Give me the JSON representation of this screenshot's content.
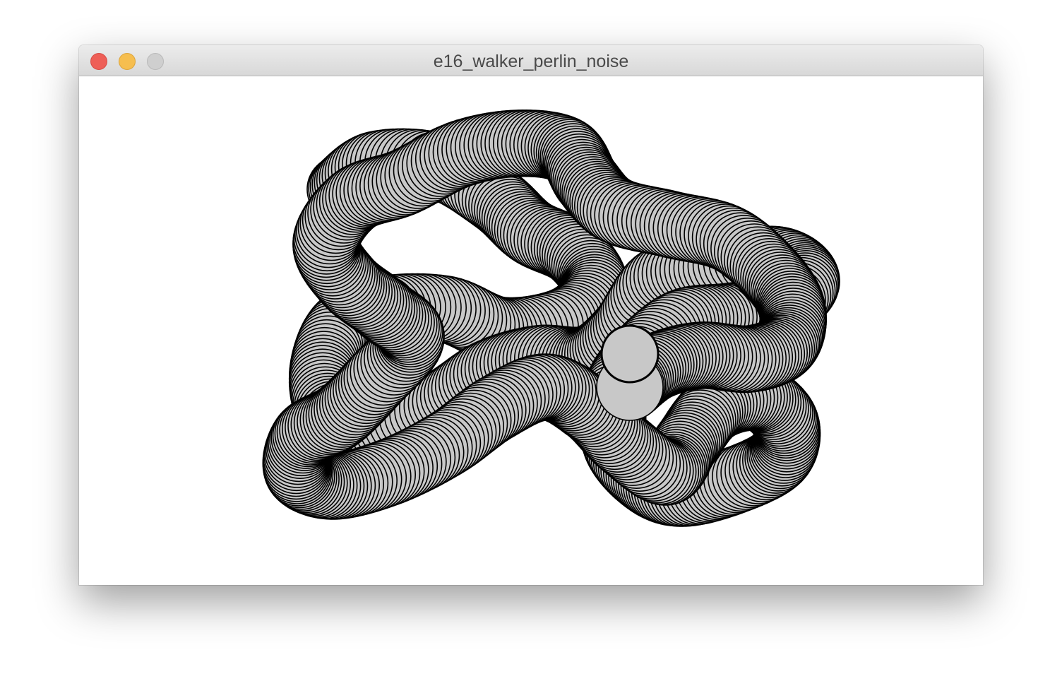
{
  "window": {
    "title": "e16_walker_perlin_noise"
  },
  "traffic_lights": {
    "close_icon": "close-icon",
    "minimize_icon": "minimize-icon",
    "zoom_icon": "zoom-icon",
    "colors": {
      "close": "#ee5f57",
      "minimize": "#f6be4f",
      "zoom": "#cfcfcf"
    }
  },
  "sketch": {
    "background_color": "#ffffff",
    "fill_color": "#c8c8c8",
    "stroke_color": "#000000",
    "description_icon": "perlin-noise-walker-trail"
  }
}
